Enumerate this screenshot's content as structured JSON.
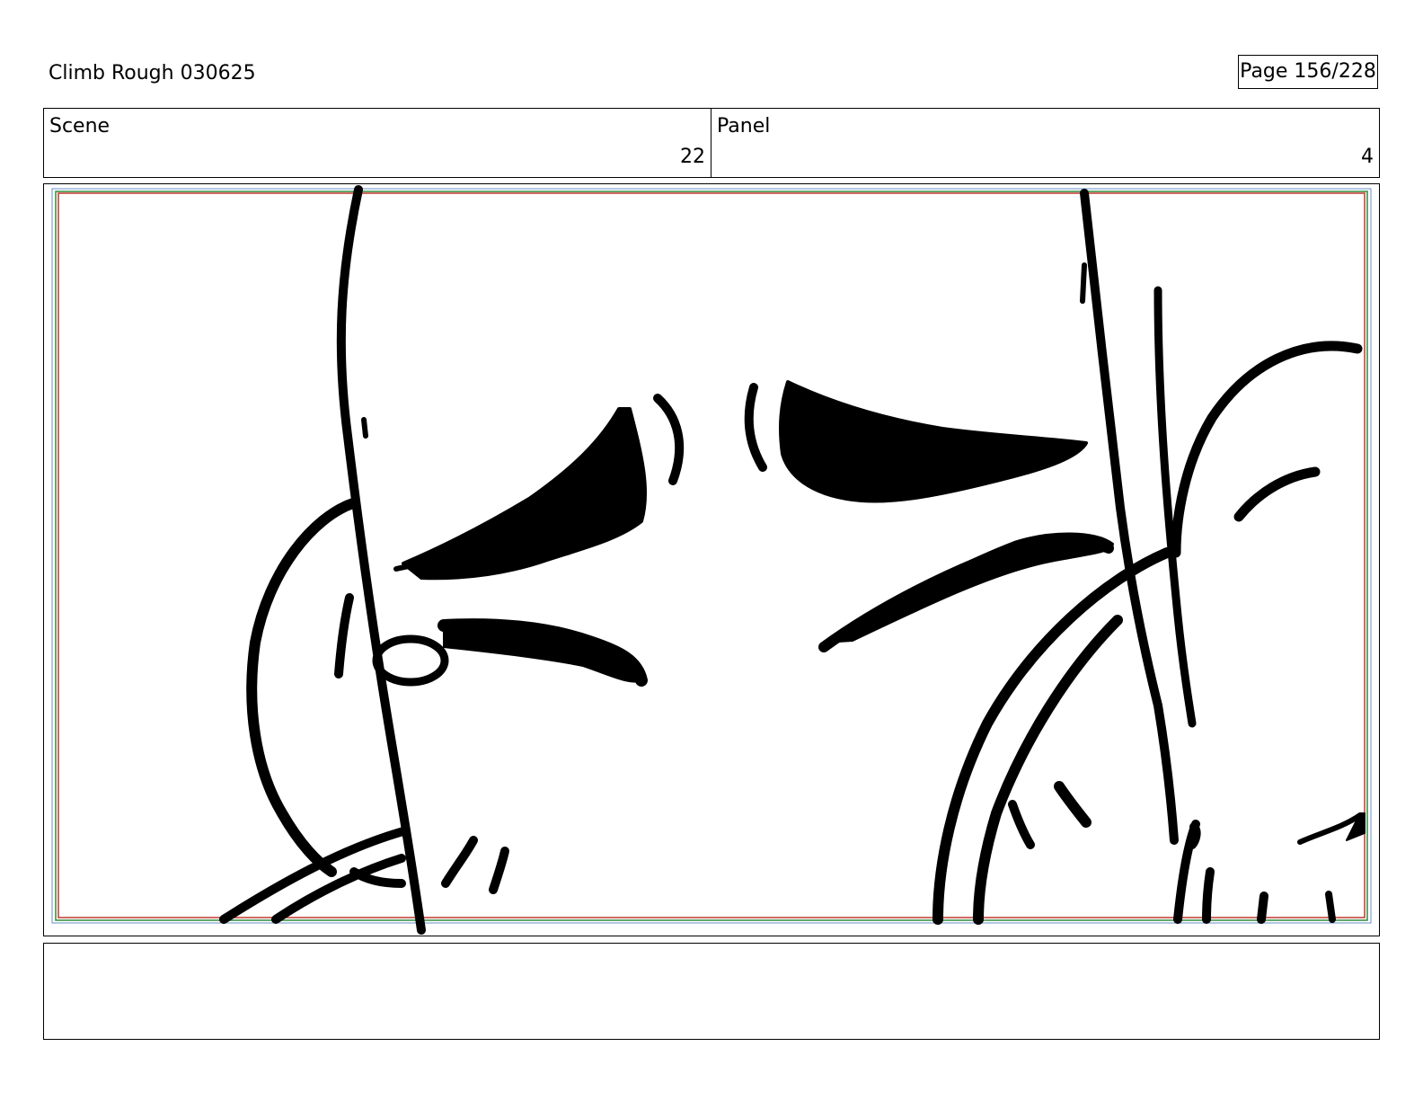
{
  "header": {
    "title": "Climb Rough 030625",
    "page": "Page 156/228"
  },
  "scene": {
    "label": "Scene",
    "value": "22"
  },
  "panel": {
    "label": "Panel",
    "value": "4"
  },
  "frame": {
    "safe_area_color": "#c0392b",
    "action_area_color": "#2e8b3e",
    "guide_color": "#6a8fc7"
  },
  "notes": {
    "text": ""
  }
}
